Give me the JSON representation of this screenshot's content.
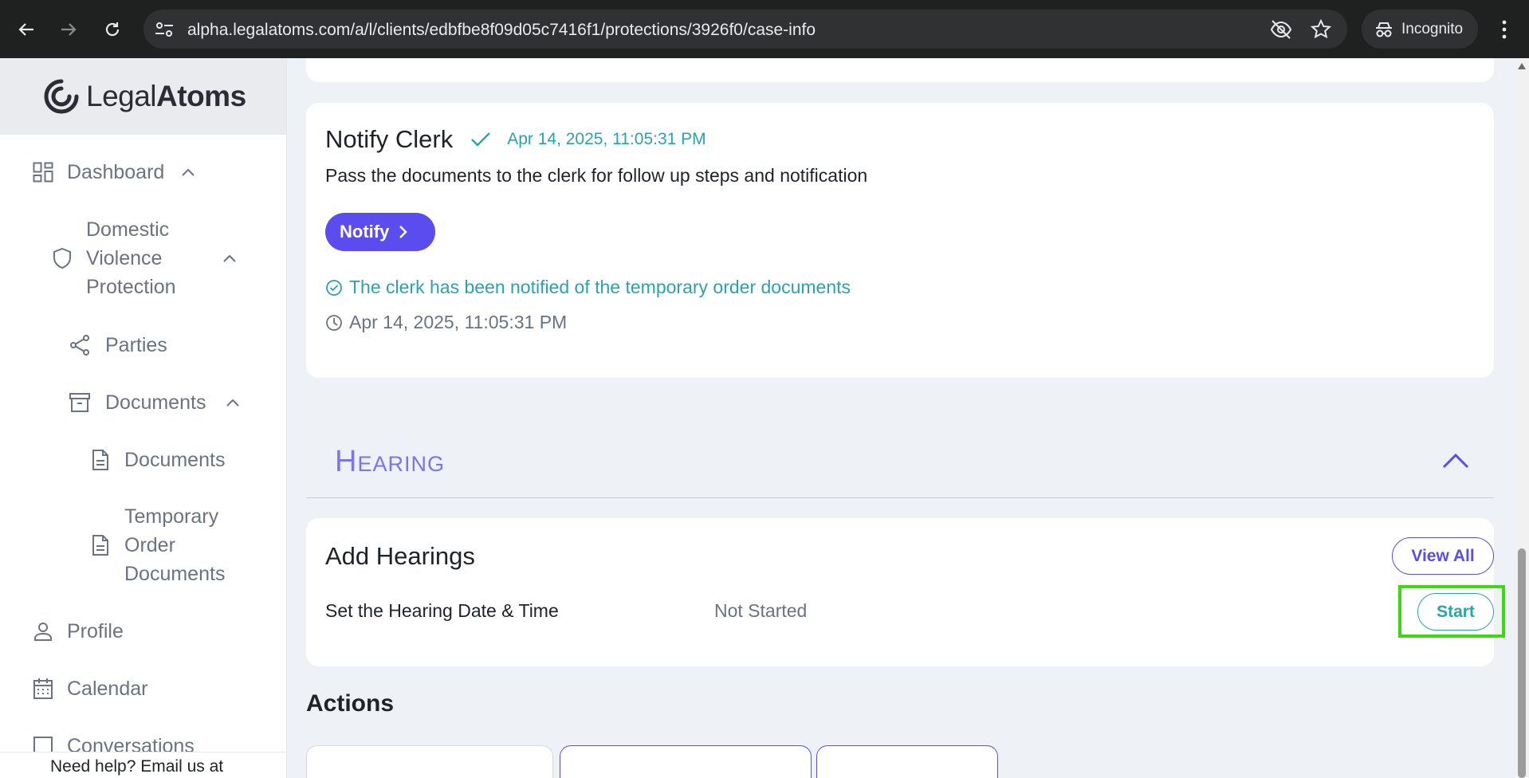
{
  "browser": {
    "url": "alpha.legalatoms.com/a/l/clients/edbfbe8f09d05c7416f1/protections/3926f0/case-info",
    "profile_label": "Incognito"
  },
  "sidebar": {
    "logo": {
      "part1": "Legal",
      "part2": "Atoms"
    },
    "items": [
      {
        "label": "Dashboard"
      },
      {
        "label": "Domestic Violence Protection"
      },
      {
        "label": "Parties"
      },
      {
        "label": "Documents"
      },
      {
        "label": "Documents"
      },
      {
        "label": "Temporary Order Documents"
      },
      {
        "label": "Profile"
      },
      {
        "label": "Calendar"
      },
      {
        "label": "Conversations"
      }
    ],
    "help_text": "Need help? Email us at"
  },
  "notify_card": {
    "title": "Notify Clerk",
    "timestamp": "Apr 14, 2025, 11:05:31 PM",
    "description": "Pass the documents to the clerk for follow up steps and notification",
    "button_label": "Notify",
    "status_message": "The clerk has been notified of the temporary order documents",
    "status_time": "Apr 14, 2025, 11:05:31 PM"
  },
  "hearing_section": {
    "title": "Hearing"
  },
  "hearing_card": {
    "title": "Add Hearings",
    "view_all_label": "View All",
    "task_label": "Set the Hearing Date & Time",
    "task_status": "Not Started",
    "start_label": "Start"
  },
  "actions": {
    "title": "Actions"
  },
  "colors": {
    "accent": "#5b4cf0",
    "teal": "#2aa3ad",
    "highlight": "#3bd90e"
  }
}
